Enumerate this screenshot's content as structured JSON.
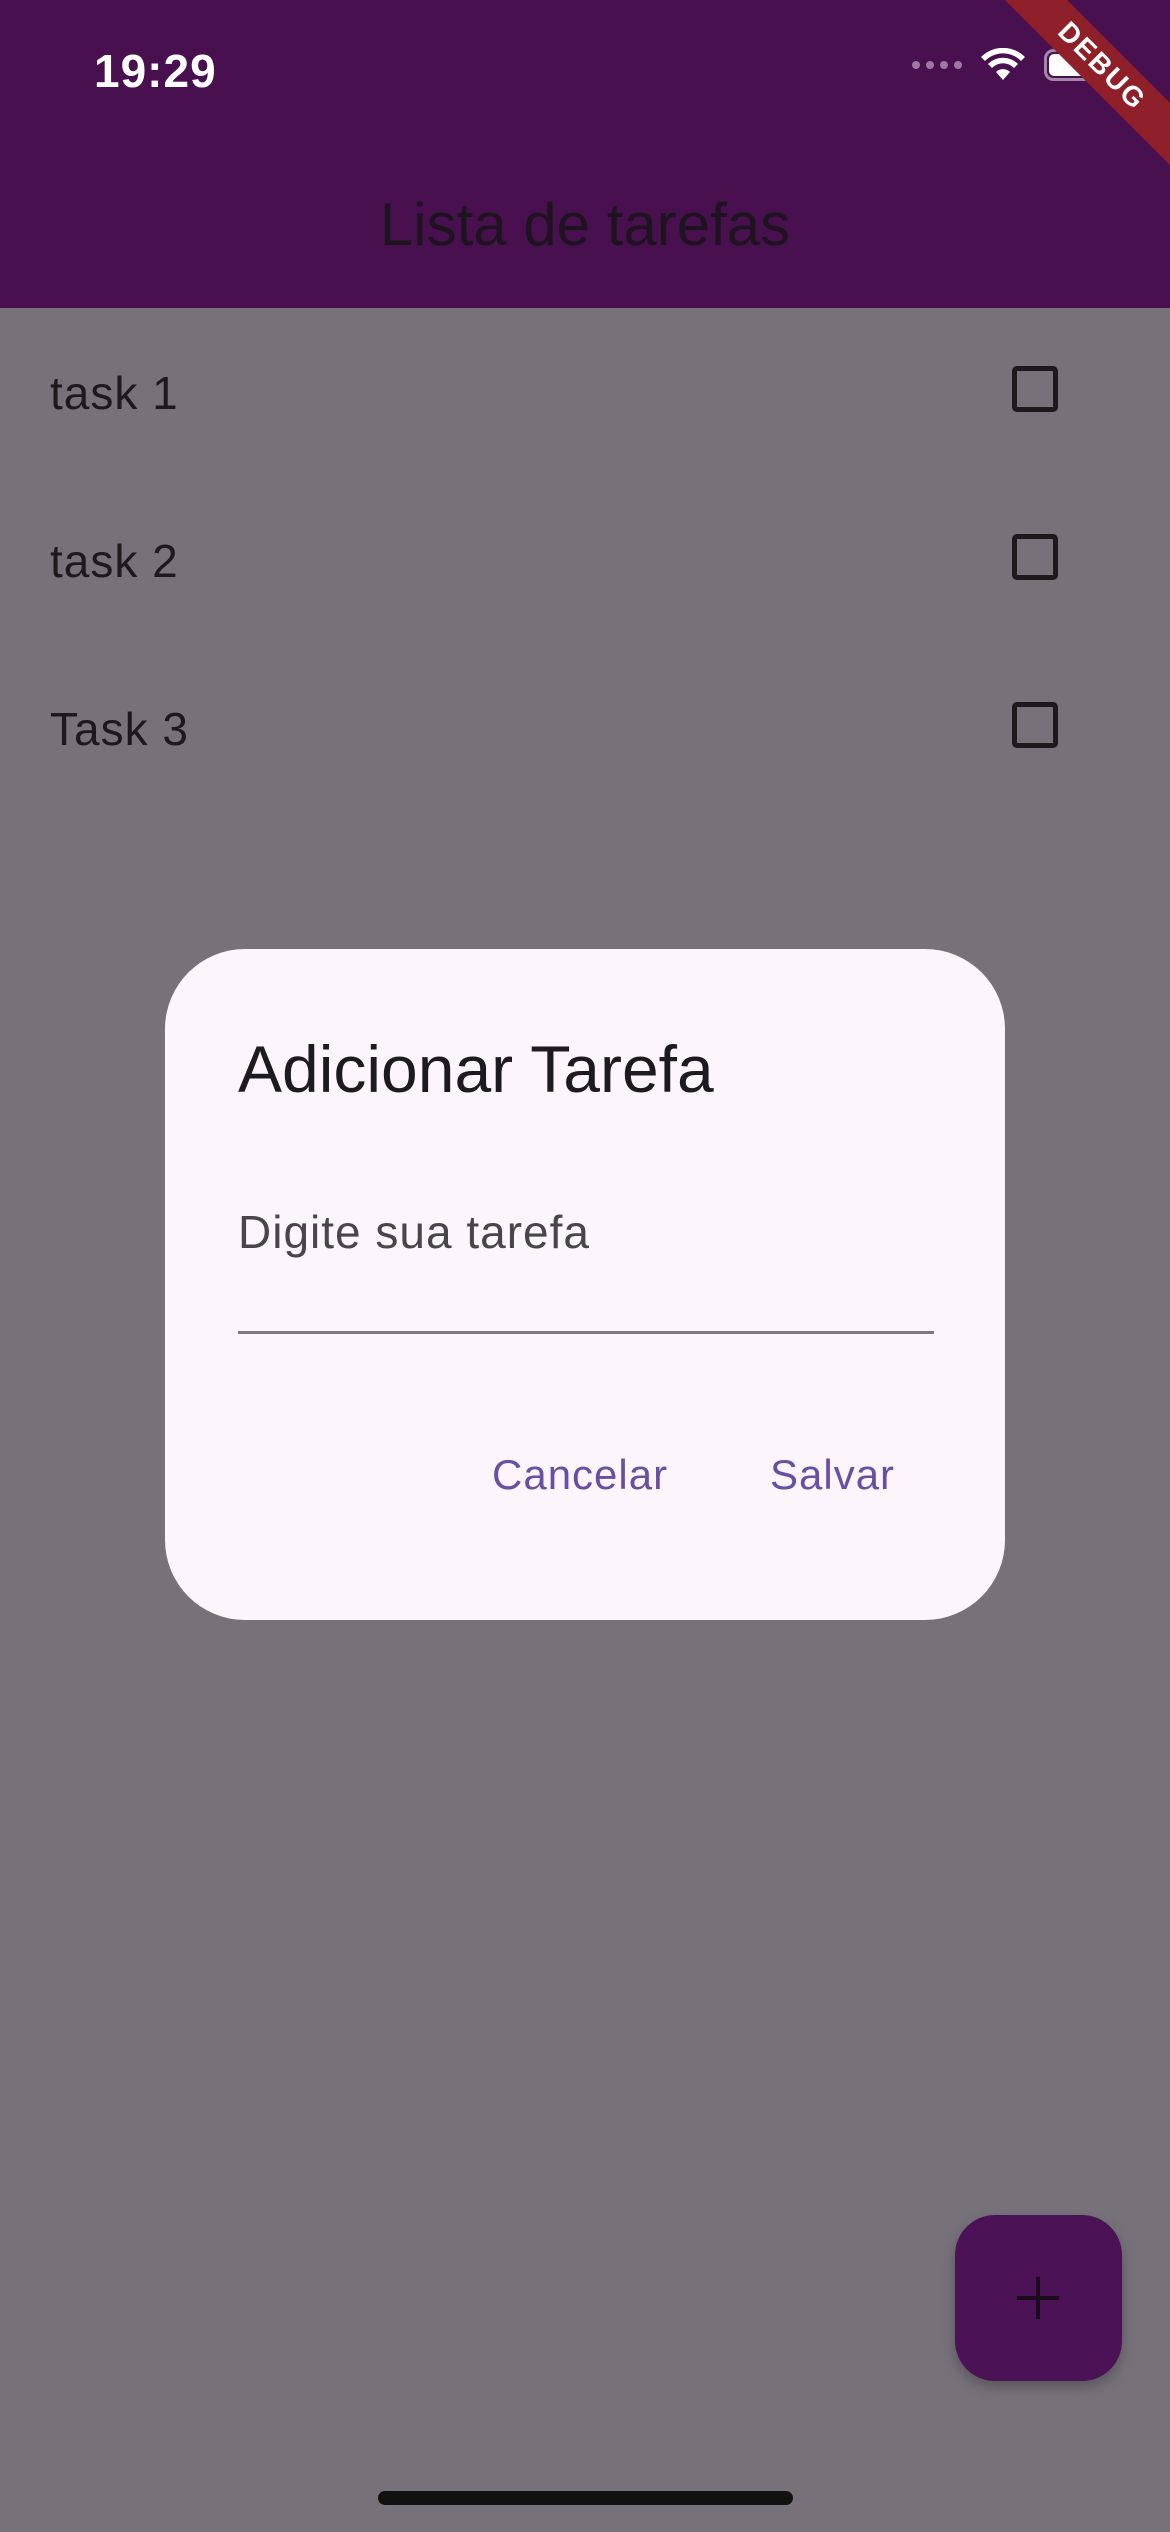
{
  "status_bar": {
    "time": "19:29",
    "wifi_icon": "wifi-icon",
    "battery_icon": "battery-icon"
  },
  "debug_banner": "DEBUG",
  "app_bar": {
    "title": "Lista de tarefas",
    "color": "#48104f"
  },
  "tasks": [
    {
      "label": "task 1",
      "checked": false
    },
    {
      "label": "task 2",
      "checked": false
    },
    {
      "label": "Task 3",
      "checked": false
    }
  ],
  "dialog": {
    "title": "Adicionar Tarefa",
    "input_placeholder": "Digite sua tarefa",
    "input_value": "",
    "cancel_label": "Cancelar",
    "save_label": "Salvar",
    "button_color": "#674fa3"
  },
  "fab": {
    "icon": "plus-icon",
    "color": "#4b1356"
  },
  "overlay_color": "#77727a"
}
